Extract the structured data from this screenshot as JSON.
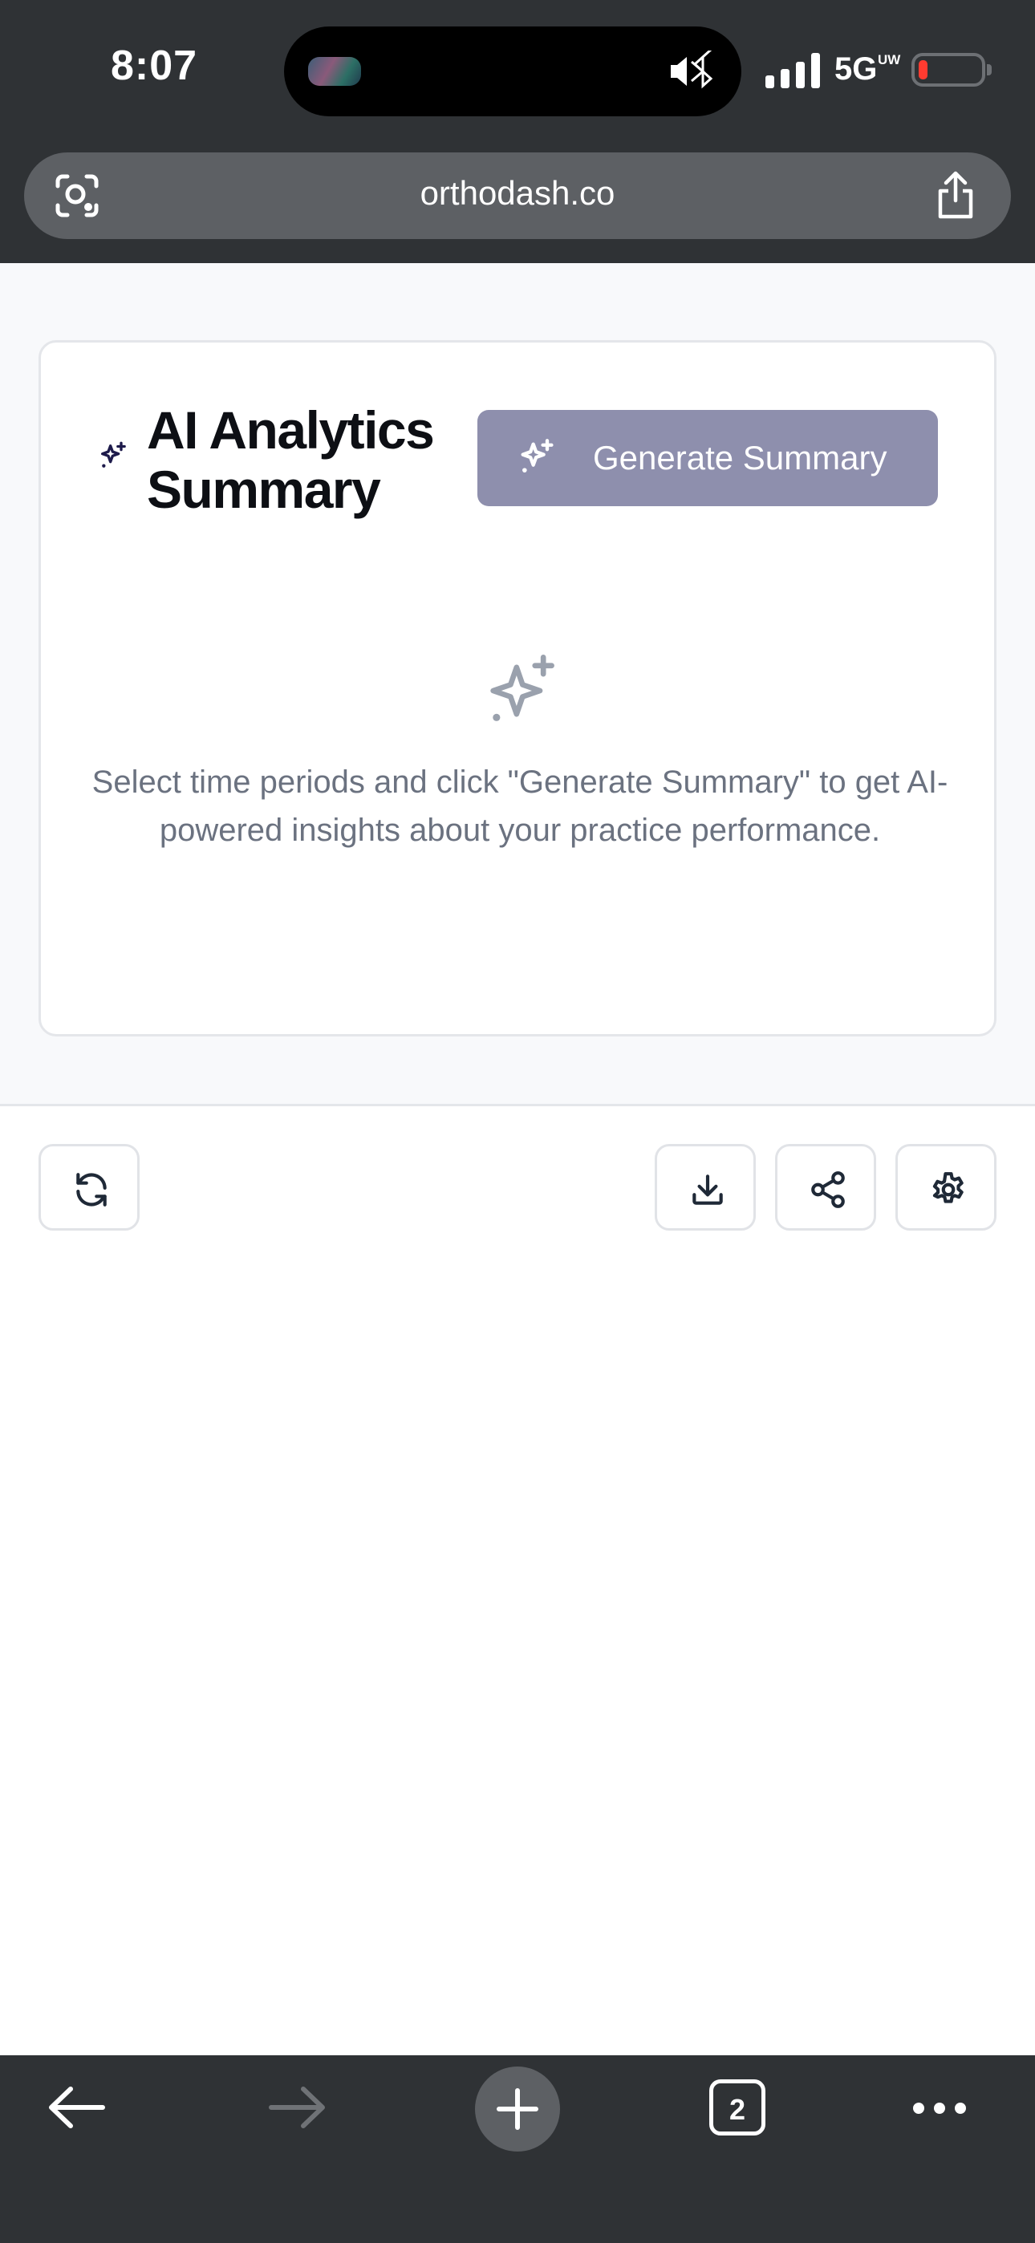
{
  "status_bar": {
    "time": "8:07",
    "network": "5G",
    "network_suffix": "UW",
    "battery_color": "#ff3b30"
  },
  "browser": {
    "url": "orthodash.co",
    "tab_count": "2",
    "icons": {
      "url_left": "camera-search-icon",
      "url_right": "share-icon",
      "back": "arrow-left-icon",
      "forward": "arrow-right-icon",
      "new_tab": "plus-icon",
      "tabs": "tabs-icon",
      "more": "more-dots-icon"
    }
  },
  "summary_card": {
    "title": "AI Analytics Summary",
    "button_label": "Generate Summary",
    "empty_message": "Select time periods and click \"Generate Summary\" to get AI-powered insights about your practice performance.",
    "icon": "sparkles-icon"
  },
  "toolbar": {
    "refresh_icon": "refresh-icon",
    "download_icon": "download-icon",
    "share_icon": "share-nodes-icon",
    "settings_icon": "gear-icon"
  },
  "colors": {
    "chrome": "#2f3235",
    "button": "#8e8fad",
    "page_bg": "#f8f9fb",
    "muted_text": "#6b7280"
  }
}
